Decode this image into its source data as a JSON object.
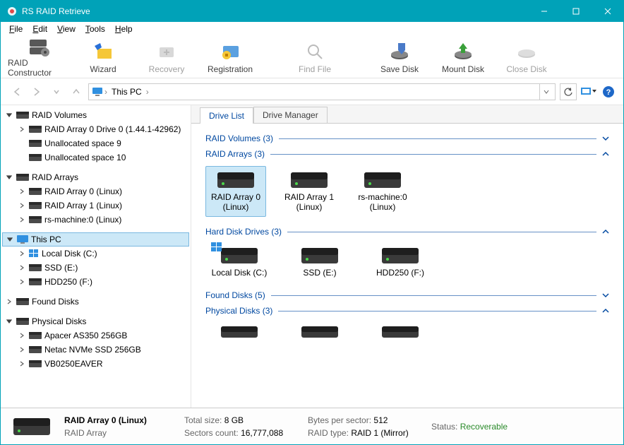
{
  "window": {
    "title": "RS RAID Retrieve"
  },
  "menu": {
    "file": "File",
    "edit": "Edit",
    "view": "View",
    "tools": "Tools",
    "help": "Help"
  },
  "toolbar": {
    "raid_constructor": "RAID Constructor",
    "wizard": "Wizard",
    "recovery": "Recovery",
    "registration": "Registration",
    "find_file": "Find File",
    "save_disk": "Save Disk",
    "mount_disk": "Mount Disk",
    "close_disk": "Close Disk"
  },
  "breadcrumb": {
    "root_sep": "›",
    "location": "This PC",
    "sep": "›"
  },
  "tree": {
    "raid_volumes": "RAID Volumes",
    "rv_items": [
      "RAID Array 0 Drive 0 (1.44.1-42962)",
      "Unallocated space 9",
      "Unallocated space 10"
    ],
    "raid_arrays": "RAID Arrays",
    "ra_items": [
      "RAID Array 0 (Linux)",
      "RAID Array 1 (Linux)",
      "rs-machine:0 (Linux)"
    ],
    "this_pc": "This PC",
    "pc_items": [
      "Local Disk (C:)",
      "SSD (E:)",
      "HDD250 (F:)"
    ],
    "found_disks": "Found Disks",
    "physical_disks": "Physical Disks",
    "pd_items": [
      "Apacer AS350 256GB",
      "Netac NVMe SSD 256GB",
      "VB0250EAVER"
    ]
  },
  "tabs": {
    "drive_list": "Drive List",
    "drive_manager": "Drive Manager"
  },
  "sections": {
    "raid_volumes": {
      "label": "RAID Volumes",
      "count": "(3)"
    },
    "raid_arrays": {
      "label": "RAID Arrays",
      "count": "(3)"
    },
    "hard_disk_drives": {
      "label": "Hard Disk Drives",
      "count": "(3)"
    },
    "found_disks": {
      "label": "Found Disks",
      "count": "(5)"
    },
    "physical_disks": {
      "label": "Physical Disks",
      "count": "(3)"
    }
  },
  "arrays_grid": [
    {
      "name": "RAID Array 0 (Linux)"
    },
    {
      "name": "RAID Array 1 (Linux)"
    },
    {
      "name": "rs-machine:0 (Linux)"
    }
  ],
  "hdd_grid": [
    {
      "name": "Local Disk (C:)"
    },
    {
      "name": "SSD (E:)"
    },
    {
      "name": "HDD250 (F:)"
    }
  ],
  "status": {
    "name": "RAID Array 0 (Linux)",
    "kind": "RAID Array",
    "total_size_label": "Total size:",
    "total_size": "8 GB",
    "sectors_label": "Sectors count:",
    "sectors": "16,777,088",
    "bps_label": "Bytes per sector:",
    "bps": "512",
    "raid_type_label": "RAID type:",
    "raid_type": "RAID 1 (Mirror)",
    "status_label": "Status:",
    "status": "Recoverable"
  }
}
